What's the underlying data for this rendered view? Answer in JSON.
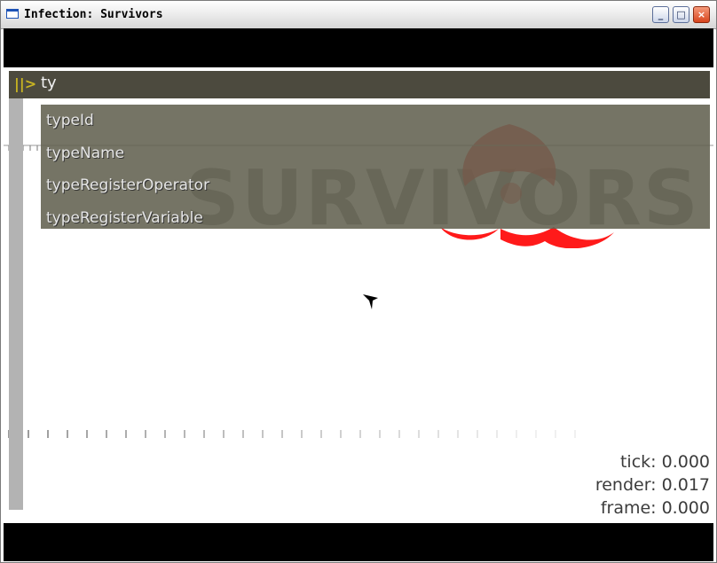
{
  "window": {
    "title": "Infection: Survivors",
    "controls": {
      "minimize": "_",
      "maximize": "□",
      "close": "×"
    }
  },
  "logo": {
    "text": "SURVIVORS",
    "symbol": "biohazard-icon",
    "symbol_color": "#ff1a1a"
  },
  "console": {
    "prompt": "||>",
    "input": "ty",
    "completions": [
      "typeId",
      "typeName",
      "typeRegisterOperator",
      "typeRegisterVariable"
    ]
  },
  "stats": {
    "tick": "tick: 0.000",
    "render": "render: 0.017",
    "frame": "frame: 0.000"
  },
  "colors": {
    "letterbox": "#000000",
    "console_bar": "#4c4a3e",
    "prompt": "#c8b422",
    "completion_bg": "#626150"
  }
}
